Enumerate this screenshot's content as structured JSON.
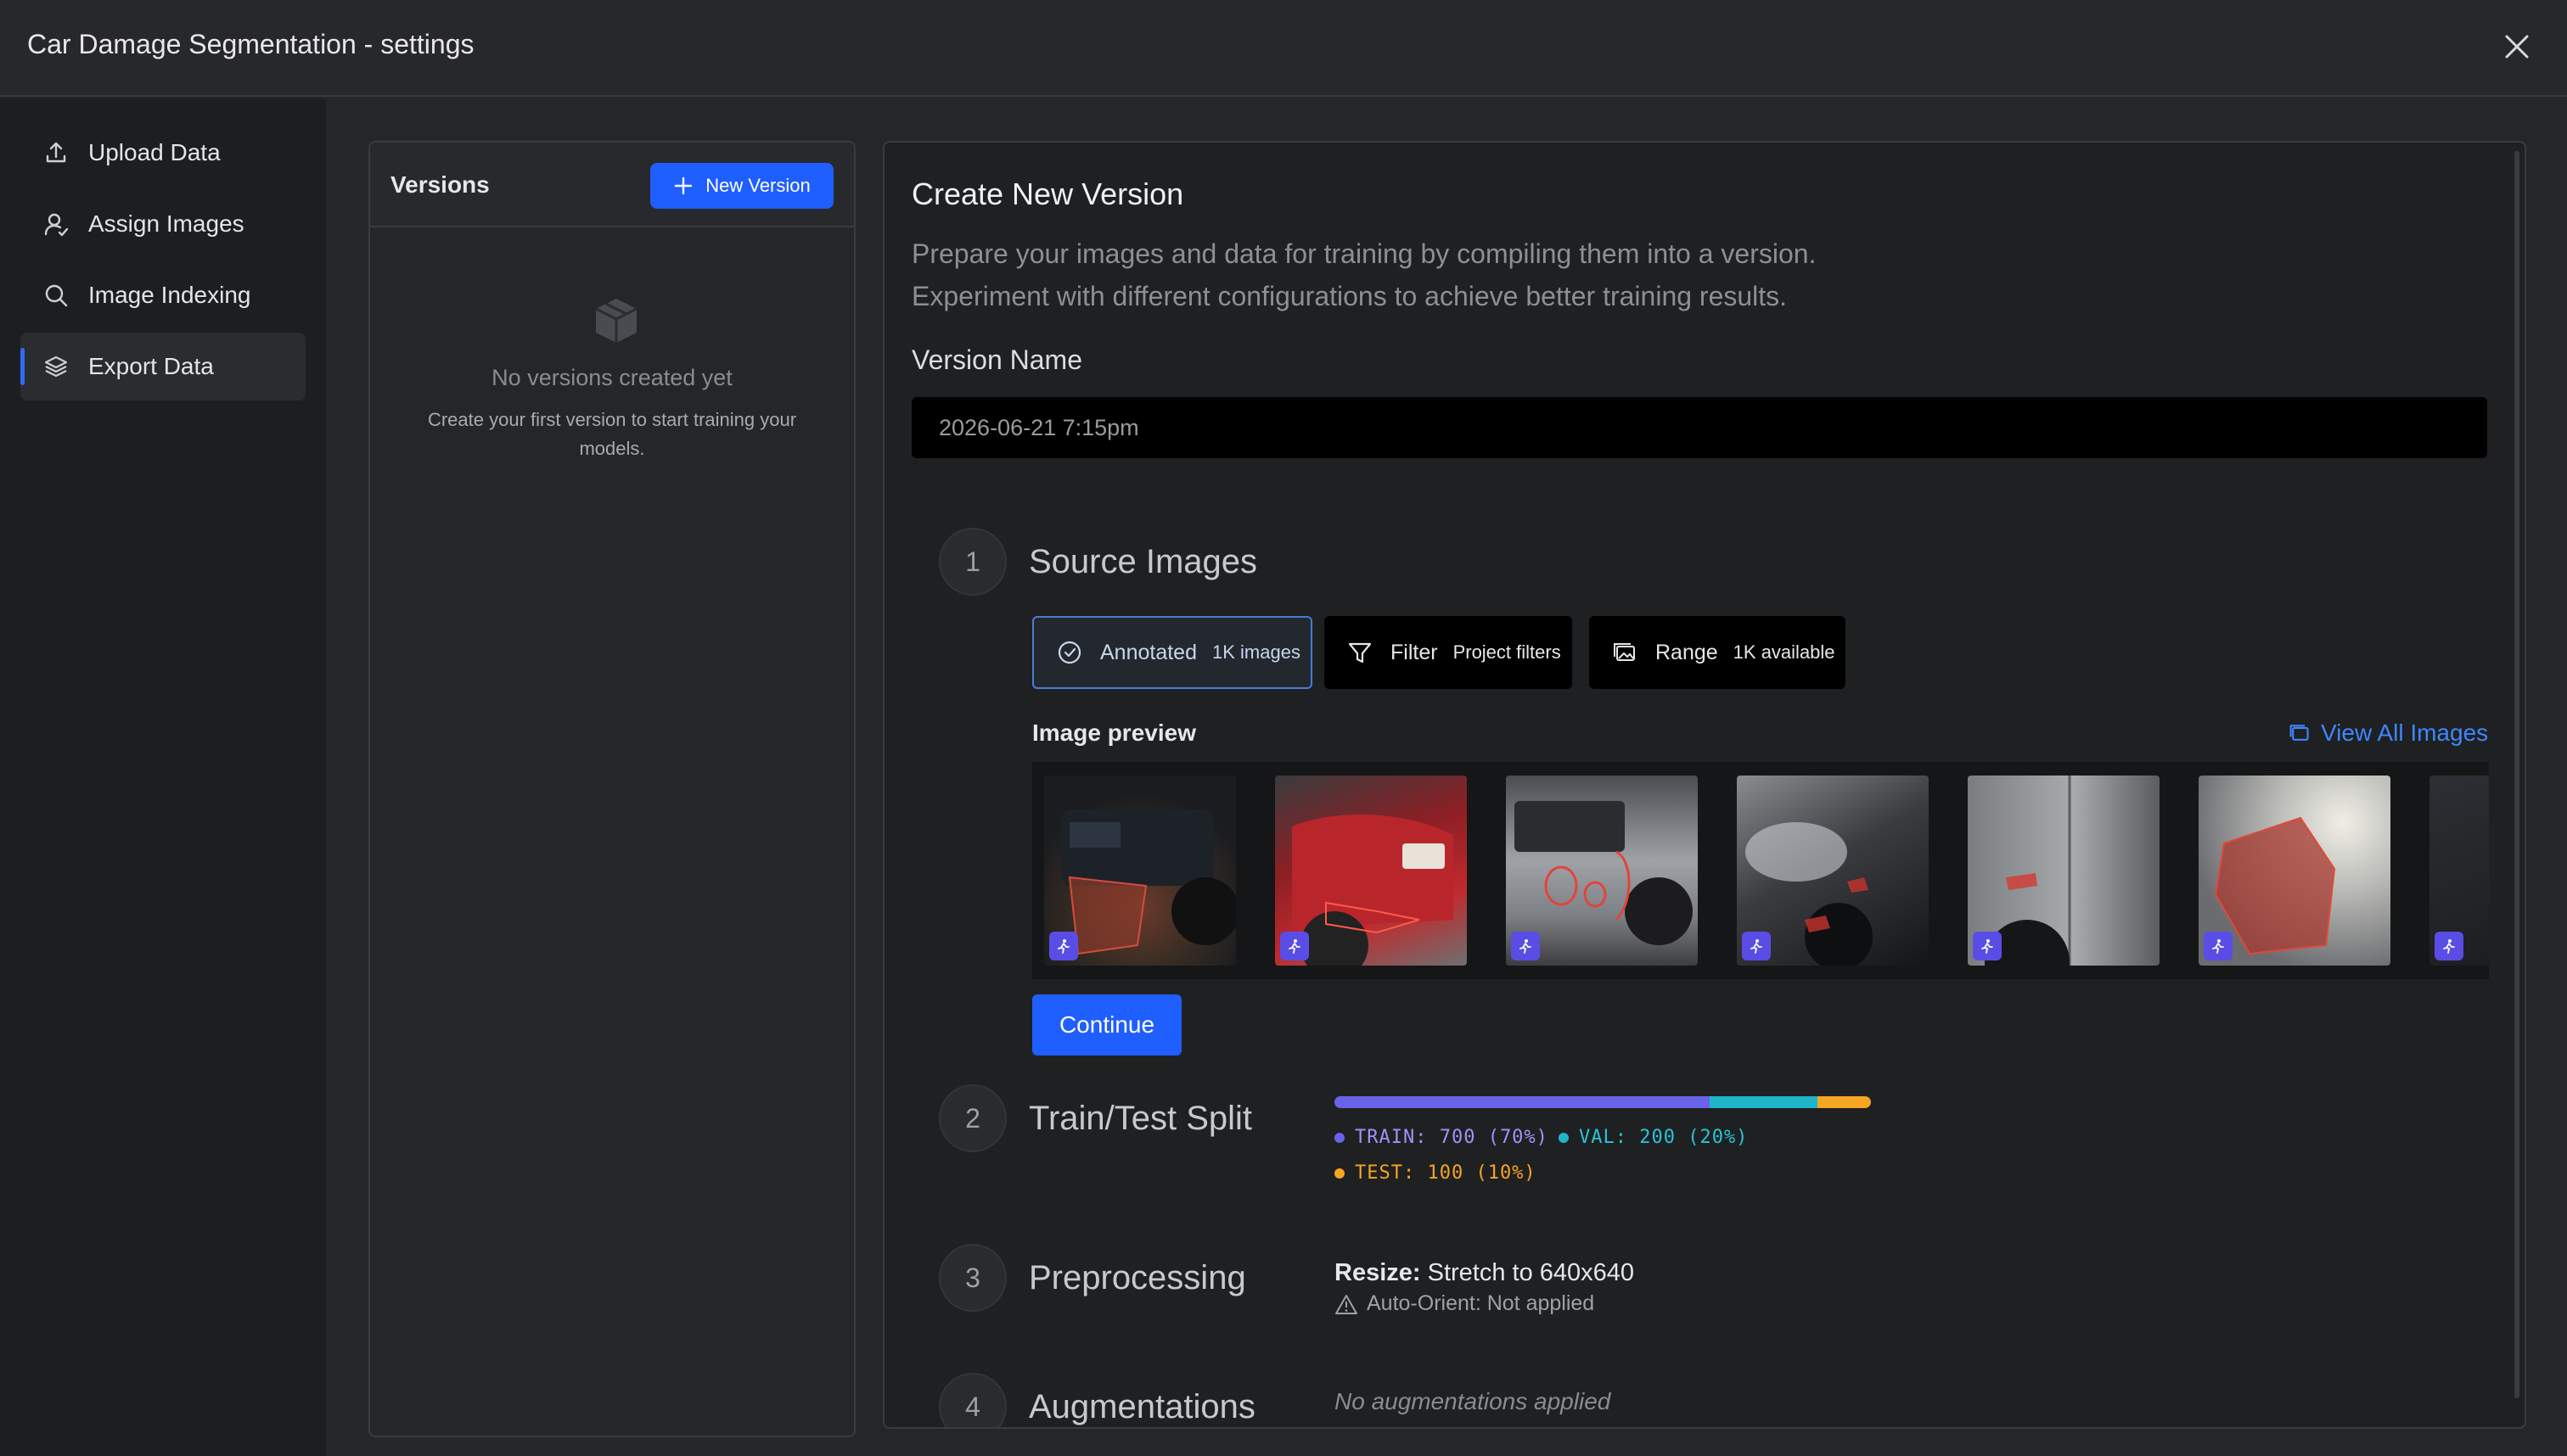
{
  "window": {
    "title": "Car Damage Segmentation - settings"
  },
  "sidebar": {
    "items": [
      {
        "label": "Upload Data",
        "icon": "upload-icon"
      },
      {
        "label": "Assign Images",
        "icon": "user-assign-icon"
      },
      {
        "label": "Image Indexing",
        "icon": "search-icon"
      },
      {
        "label": "Export Data",
        "icon": "layers-icon",
        "active": true
      }
    ]
  },
  "versions": {
    "title": "Versions",
    "new_button": "New Version",
    "empty_title": "No versions created yet",
    "empty_subtitle": "Create your first version to start training your models."
  },
  "create": {
    "title": "Create New Version",
    "description_line1": "Prepare your images and data for training by compiling them into a version.",
    "description_line2": "Experiment with different configurations to achieve better training results.",
    "version_name_label": "Version Name",
    "version_name_value": "2026-06-21 7:15pm"
  },
  "steps": {
    "source": {
      "number": "1",
      "title": "Source Images",
      "options": [
        {
          "label": "Annotated",
          "sub": "1K images",
          "icon": "check-circle-icon",
          "selected": true
        },
        {
          "label": "Filter",
          "sub": "Project filters",
          "icon": "filter-icon",
          "selected": false
        },
        {
          "label": "Range",
          "sub": "1K available",
          "icon": "images-icon",
          "selected": false
        }
      ],
      "preview_label": "Image preview",
      "view_all": "View All Images",
      "continue": "Continue"
    },
    "split": {
      "number": "2",
      "title": "Train/Test Split",
      "train_label": "TRAIN: 700 (70%)",
      "val_label": "VAL: 200 (20%)",
      "test_label": "TEST: 100 (10%)",
      "train_pct": 70,
      "val_pct": 20,
      "test_pct": 10,
      "colors": {
        "train": "#6a63e8",
        "val": "#1fb6c9",
        "test": "#f5a623"
      }
    },
    "preprocessing": {
      "number": "3",
      "title": "Preprocessing",
      "resize_key": "Resize:",
      "resize_value": "Stretch to 640x640",
      "auto_orient": "Auto-Orient: Not applied"
    },
    "augmentations": {
      "number": "4",
      "title": "Augmentations",
      "none": "No augmentations applied"
    }
  },
  "accent": "#1f5eff"
}
